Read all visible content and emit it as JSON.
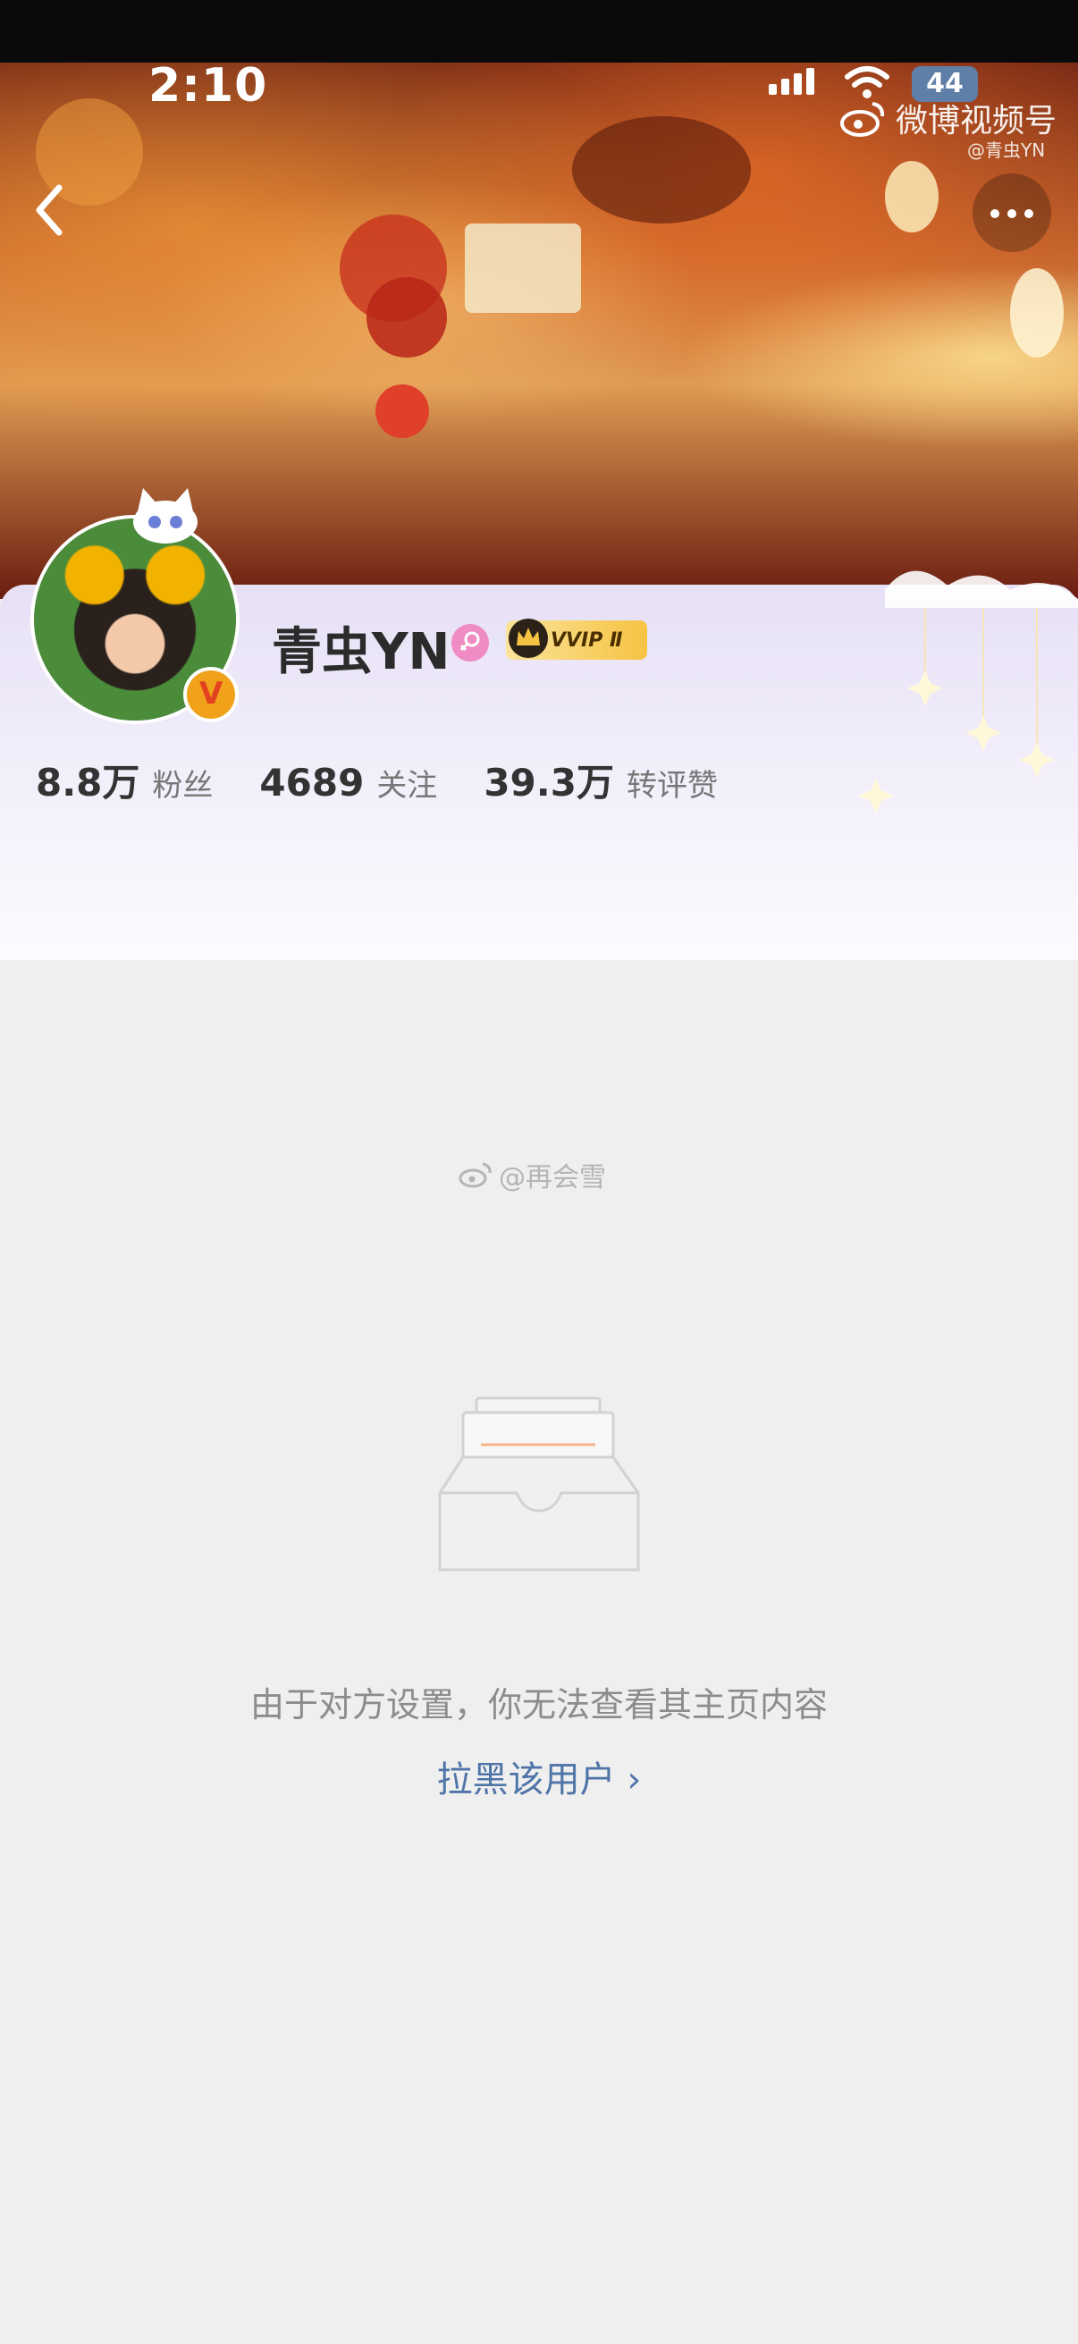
{
  "status_bar": {
    "time": "2:10",
    "battery": "44"
  },
  "watermark_banner": {
    "title": "微博视频号",
    "handle": "@青虫YN"
  },
  "profile": {
    "username": "青虫YN",
    "vip_badge": "VVIP Ⅱ",
    "verified_mark": "V",
    "stats": [
      {
        "value": "8.8万",
        "label": "粉丝"
      },
      {
        "value": "4689",
        "label": "关注"
      },
      {
        "value": "39.3万",
        "label": "转评赞"
      }
    ]
  },
  "content": {
    "watermark": "@再会雪",
    "restricted_message": "由于对方设置，你无法查看其主页内容",
    "block_link": "拉黑该用户 ›"
  },
  "icons": [
    "back-icon",
    "more-icon",
    "weibo-logo-icon",
    "gender-female-icon",
    "crown-icon",
    "verified-icon",
    "empty-inbox-icon"
  ],
  "colors": {
    "link": "#4f74a8",
    "background": "#efefef",
    "vip_gold": "#f6c343",
    "verified": "#f0a21a"
  }
}
